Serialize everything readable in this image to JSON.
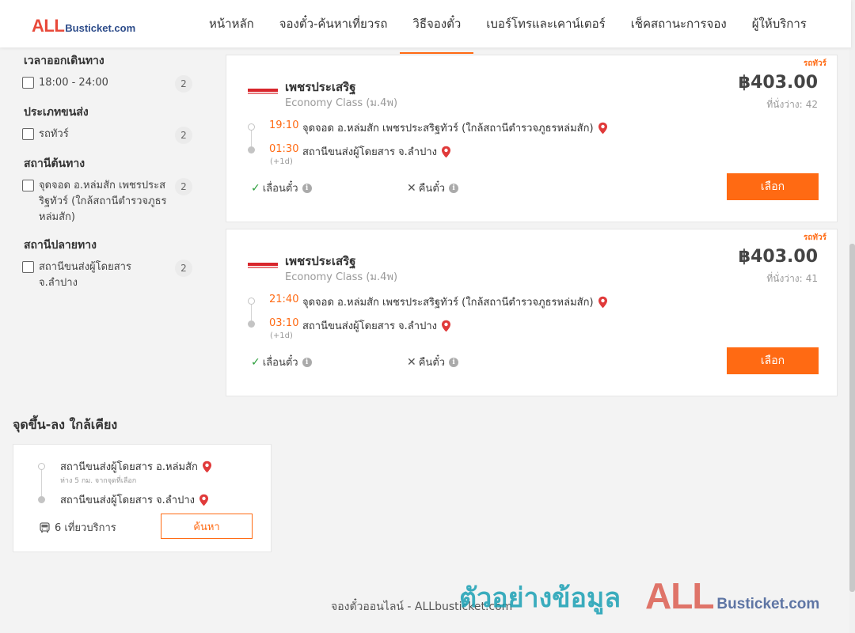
{
  "brand": {
    "logo_all": "ALL",
    "logo_rest": "Busticket.com"
  },
  "nav": [
    {
      "label": "หน้าหลัก"
    },
    {
      "label": "จองตั๋ว-ค้นหาเที่ยวรถ"
    },
    {
      "label": "วิธีจองตั๋ว",
      "active": true
    },
    {
      "label": "เบอร์โทรและเคาน์เตอร์"
    },
    {
      "label": "เช็คสถานะการจอง"
    },
    {
      "label": "ผู้ให้บริการ"
    }
  ],
  "filters": {
    "departure_time": {
      "title": "เวลาออกเดินทาง",
      "options": [
        {
          "label": "18:00 - 24:00",
          "count": "2",
          "checked": false
        }
      ]
    },
    "transport_type": {
      "title": "ประเภทขนส่ง",
      "options": [
        {
          "label": "รถทัวร์",
          "count": "2",
          "checked": false
        }
      ]
    },
    "origin_station": {
      "title": "สถานีต้นทาง",
      "options": [
        {
          "label": "จุดจอด อ.หล่มสัก เพชรประสริฐทัวร์ (ใกล้สถานีตำรวจภูธรหล่มสัก)",
          "count": "2",
          "checked": false
        }
      ]
    },
    "destination_station": {
      "title": "สถานีปลายทาง",
      "options": [
        {
          "label": "สถานีขนส่งผู้โดยสาร จ.ลำปาง",
          "count": "2",
          "checked": false
        }
      ]
    }
  },
  "trips": [
    {
      "type_tag": "รถทัวร์",
      "operator": "เพชรประเสริฐ",
      "bus_class": "Economy Class (ม.4พ)",
      "price": "฿403.00",
      "seats_label": "ที่นั่งว่าง:",
      "seats": "42",
      "departure_time": "19:10",
      "departure_station": "จุดจอด อ.หล่มสัก เพชรประสริฐทัวร์ (ใกล้สถานีตำรวจภูธรหล่มสัก)",
      "arrival_time": "01:30",
      "arrival_station": "สถานีขนส่งผู้โดยสาร จ.ลำปาง",
      "next_day": "(+1d)",
      "feature_change": "เลื่อนตั๋ว",
      "feature_refund": "คืนตั๋ว",
      "select_label": "เลือก"
    },
    {
      "type_tag": "รถทัวร์",
      "operator": "เพชรประเสริฐ",
      "bus_class": "Economy Class (ม.4พ)",
      "price": "฿403.00",
      "seats_label": "ที่นั่งว่าง:",
      "seats": "41",
      "departure_time": "21:40",
      "departure_station": "จุดจอด อ.หล่มสัก เพชรประสริฐทัวร์ (ใกล้สถานีตำรวจภูธรหล่มสัก)",
      "arrival_time": "03:10",
      "arrival_station": "สถานีขนส่งผู้โดยสาร จ.ลำปาง",
      "next_day": "(+1d)",
      "feature_change": "เลื่อนตั๋ว",
      "feature_refund": "คืนตั๋ว",
      "select_label": "เลือก"
    }
  ],
  "nearby": {
    "title": "จุดขึ้น-ลง ใกล้เคียง",
    "from_station": "สถานีขนส่งผู้โดยสาร อ.หล่มสัก",
    "distance_note": "ห่าง 5 กม. จากจุดที่เลือก",
    "to_station": "สถานีขนส่งผู้โดยสาร จ.ลำปาง",
    "trips_count": "6 เที่ยวบริการ",
    "search_label": "ค้นหา"
  },
  "footer": {
    "text": "จองตั๋วออนไลน์ - ALLbusticket.com"
  },
  "watermark": {
    "text": "ตัวอย่างข้อมูล",
    "logo_all": "ALL",
    "logo_rest": "Busticket.com"
  },
  "colors": {
    "accent": "#ff6a13",
    "brand_red": "#e8493a",
    "brand_blue": "#2d4c8a",
    "check_green": "#2a9d3a",
    "pin_red": "#e03a3a",
    "watermark_teal": "#1aa0b4"
  },
  "icons": {
    "pin": "map-pin-icon",
    "check": "check-icon",
    "cross": "cross-icon",
    "info": "info-icon",
    "bus": "bus-icon"
  }
}
